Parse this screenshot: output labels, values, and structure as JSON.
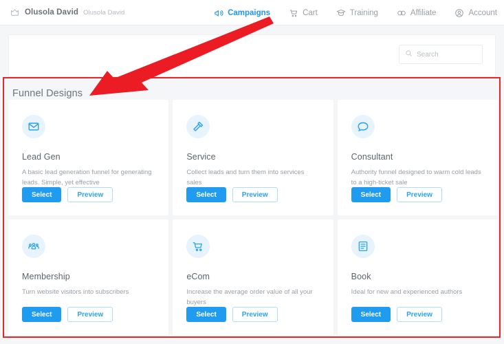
{
  "topnav": {
    "brand": {
      "icon": "crown-icon",
      "name": "Olusola David",
      "sub": "Olusola David"
    },
    "items": [
      {
        "label": "Campaigns",
        "icon": "megaphone-icon",
        "active": true
      },
      {
        "label": "Cart",
        "icon": "shopping-cart-icon",
        "active": false
      },
      {
        "label": "Training",
        "icon": "graduation-cap-icon",
        "active": false
      },
      {
        "label": "Affiliate",
        "icon": "handshake-icon",
        "active": false
      },
      {
        "label": "Account",
        "icon": "user-circle-icon",
        "active": false
      }
    ]
  },
  "search": {
    "placeholder": "Search",
    "value": "",
    "icon": "search-icon"
  },
  "section": {
    "title": "Funnel Designs"
  },
  "buttons": {
    "select": "Select",
    "preview": "Preview"
  },
  "cards": [
    {
      "title": "Lead Gen",
      "desc": "A basic lead generation funnel for generating leads. Simple, yet effective",
      "icon": "envelope-icon"
    },
    {
      "title": "Service",
      "desc": "Collect leads and turn them into services sales",
      "icon": "hammer-icon"
    },
    {
      "title": "Consultant",
      "desc": "Authority funnel designed to warm cold leads to a high-ticket sale",
      "icon": "speech-bubble-icon"
    },
    {
      "title": "Membership",
      "desc": "Turn website visitors into subscribers",
      "icon": "users-group-icon"
    },
    {
      "title": "eCom",
      "desc": "Increase the average order value of all your buyers",
      "icon": "shopping-cart-icon"
    },
    {
      "title": "Book",
      "desc": "Ideal for new and experienced authors",
      "icon": "book-icon"
    }
  ],
  "annotation": {
    "arrow_color": "#ec1c24",
    "highlight_color": "#e8262a"
  },
  "colors": {
    "accent": "#1f9cf0",
    "accent_light": "#e7f3fd",
    "page_bg": "#f4f6f8",
    "text_muted": "#9aa0a6"
  }
}
